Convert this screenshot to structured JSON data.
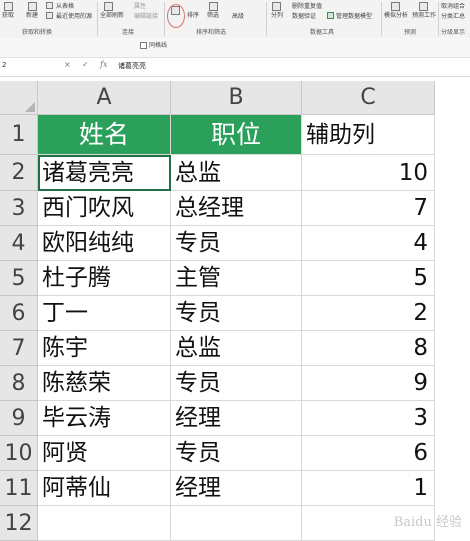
{
  "ribbon": {
    "items": [
      "获取",
      "新建",
      "从表格",
      "最近使用的源",
      "全部刷新",
      "属性",
      "编辑链接",
      "排序",
      "筛选",
      "高级",
      "分列",
      "删除重复值",
      "数据验证",
      "管理数据模型",
      "模拟分析",
      "预测工作表",
      "取消组合",
      "分类汇总"
    ],
    "groups": [
      "获取和转换",
      "连接",
      "排序和筛选",
      "数据工具",
      "预测",
      "分级显示"
    ],
    "checkbox_label": "同格线"
  },
  "formula_bar": {
    "name_box": "2",
    "cancel": "×",
    "enter": "✓",
    "fx": "fx",
    "value": "诸葛亮亮"
  },
  "grid": {
    "columns": [
      "A",
      "B",
      "C"
    ],
    "rows": [
      "1",
      "2",
      "3",
      "4",
      "5",
      "6",
      "7",
      "8",
      "9",
      "10",
      "11",
      "12"
    ],
    "header": [
      "姓名",
      "职位",
      "辅助列"
    ],
    "data": [
      [
        "诸葛亮亮",
        "总监",
        "10"
      ],
      [
        "西门吹风",
        "总经理",
        "7"
      ],
      [
        "欧阳纯纯",
        "专员",
        "4"
      ],
      [
        "杜子腾",
        "主管",
        "5"
      ],
      [
        "丁一",
        "专员",
        "2"
      ],
      [
        "陈宇",
        "总监",
        "8"
      ],
      [
        "陈慈荣",
        "专员",
        "9"
      ],
      [
        "毕云涛",
        "经理",
        "3"
      ],
      [
        "阿贤",
        "专员",
        "6"
      ],
      [
        "阿蒂仙",
        "经理",
        "1"
      ]
    ]
  },
  "colors": {
    "header_fill": "#2aa05a",
    "selection": "#1e7145"
  },
  "watermark": "Baidu 经验"
}
